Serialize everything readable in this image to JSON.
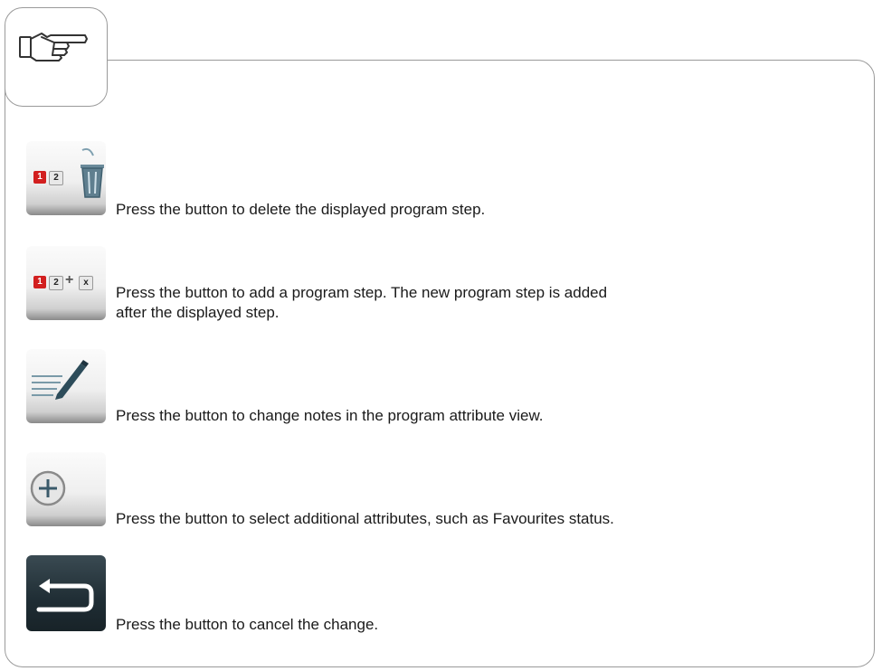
{
  "items": [
    {
      "icon": "delete-step-icon",
      "text": "Press the button to delete the displayed program step."
    },
    {
      "icon": "add-step-icon",
      "text_line1": "Press the button to add a program step. The new program step is added",
      "text_line2": "after the displayed step."
    },
    {
      "icon": "edit-notes-icon",
      "text": "Press the button to change notes in the program attribute view."
    },
    {
      "icon": "add-attribute-icon",
      "text": "Press the button to select additional attributes, such as Favourites status."
    },
    {
      "icon": "back-icon",
      "text": "Press the button to cancel the change."
    }
  ],
  "step_labels": {
    "one": "1",
    "two": "2",
    "x": "x",
    "plus": "+"
  }
}
